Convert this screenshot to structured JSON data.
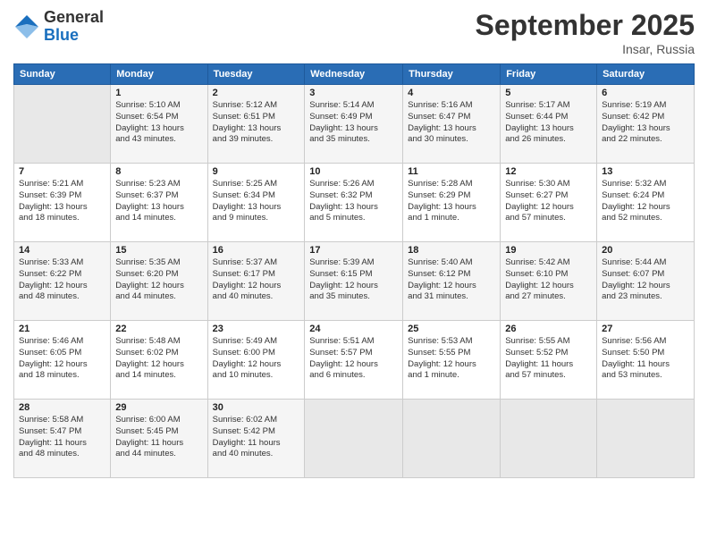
{
  "header": {
    "logo_general": "General",
    "logo_blue": "Blue",
    "month_title": "September 2025",
    "location": "Insar, Russia"
  },
  "weekdays": [
    "Sunday",
    "Monday",
    "Tuesday",
    "Wednesday",
    "Thursday",
    "Friday",
    "Saturday"
  ],
  "weeks": [
    [
      {
        "day": "",
        "info": ""
      },
      {
        "day": "1",
        "info": "Sunrise: 5:10 AM\nSunset: 6:54 PM\nDaylight: 13 hours\nand 43 minutes."
      },
      {
        "day": "2",
        "info": "Sunrise: 5:12 AM\nSunset: 6:51 PM\nDaylight: 13 hours\nand 39 minutes."
      },
      {
        "day": "3",
        "info": "Sunrise: 5:14 AM\nSunset: 6:49 PM\nDaylight: 13 hours\nand 35 minutes."
      },
      {
        "day": "4",
        "info": "Sunrise: 5:16 AM\nSunset: 6:47 PM\nDaylight: 13 hours\nand 30 minutes."
      },
      {
        "day": "5",
        "info": "Sunrise: 5:17 AM\nSunset: 6:44 PM\nDaylight: 13 hours\nand 26 minutes."
      },
      {
        "day": "6",
        "info": "Sunrise: 5:19 AM\nSunset: 6:42 PM\nDaylight: 13 hours\nand 22 minutes."
      }
    ],
    [
      {
        "day": "7",
        "info": "Sunrise: 5:21 AM\nSunset: 6:39 PM\nDaylight: 13 hours\nand 18 minutes."
      },
      {
        "day": "8",
        "info": "Sunrise: 5:23 AM\nSunset: 6:37 PM\nDaylight: 13 hours\nand 14 minutes."
      },
      {
        "day": "9",
        "info": "Sunrise: 5:25 AM\nSunset: 6:34 PM\nDaylight: 13 hours\nand 9 minutes."
      },
      {
        "day": "10",
        "info": "Sunrise: 5:26 AM\nSunset: 6:32 PM\nDaylight: 13 hours\nand 5 minutes."
      },
      {
        "day": "11",
        "info": "Sunrise: 5:28 AM\nSunset: 6:29 PM\nDaylight: 13 hours\nand 1 minute."
      },
      {
        "day": "12",
        "info": "Sunrise: 5:30 AM\nSunset: 6:27 PM\nDaylight: 12 hours\nand 57 minutes."
      },
      {
        "day": "13",
        "info": "Sunrise: 5:32 AM\nSunset: 6:24 PM\nDaylight: 12 hours\nand 52 minutes."
      }
    ],
    [
      {
        "day": "14",
        "info": "Sunrise: 5:33 AM\nSunset: 6:22 PM\nDaylight: 12 hours\nand 48 minutes."
      },
      {
        "day": "15",
        "info": "Sunrise: 5:35 AM\nSunset: 6:20 PM\nDaylight: 12 hours\nand 44 minutes."
      },
      {
        "day": "16",
        "info": "Sunrise: 5:37 AM\nSunset: 6:17 PM\nDaylight: 12 hours\nand 40 minutes."
      },
      {
        "day": "17",
        "info": "Sunrise: 5:39 AM\nSunset: 6:15 PM\nDaylight: 12 hours\nand 35 minutes."
      },
      {
        "day": "18",
        "info": "Sunrise: 5:40 AM\nSunset: 6:12 PM\nDaylight: 12 hours\nand 31 minutes."
      },
      {
        "day": "19",
        "info": "Sunrise: 5:42 AM\nSunset: 6:10 PM\nDaylight: 12 hours\nand 27 minutes."
      },
      {
        "day": "20",
        "info": "Sunrise: 5:44 AM\nSunset: 6:07 PM\nDaylight: 12 hours\nand 23 minutes."
      }
    ],
    [
      {
        "day": "21",
        "info": "Sunrise: 5:46 AM\nSunset: 6:05 PM\nDaylight: 12 hours\nand 18 minutes."
      },
      {
        "day": "22",
        "info": "Sunrise: 5:48 AM\nSunset: 6:02 PM\nDaylight: 12 hours\nand 14 minutes."
      },
      {
        "day": "23",
        "info": "Sunrise: 5:49 AM\nSunset: 6:00 PM\nDaylight: 12 hours\nand 10 minutes."
      },
      {
        "day": "24",
        "info": "Sunrise: 5:51 AM\nSunset: 5:57 PM\nDaylight: 12 hours\nand 6 minutes."
      },
      {
        "day": "25",
        "info": "Sunrise: 5:53 AM\nSunset: 5:55 PM\nDaylight: 12 hours\nand 1 minute."
      },
      {
        "day": "26",
        "info": "Sunrise: 5:55 AM\nSunset: 5:52 PM\nDaylight: 11 hours\nand 57 minutes."
      },
      {
        "day": "27",
        "info": "Sunrise: 5:56 AM\nSunset: 5:50 PM\nDaylight: 11 hours\nand 53 minutes."
      }
    ],
    [
      {
        "day": "28",
        "info": "Sunrise: 5:58 AM\nSunset: 5:47 PM\nDaylight: 11 hours\nand 48 minutes."
      },
      {
        "day": "29",
        "info": "Sunrise: 6:00 AM\nSunset: 5:45 PM\nDaylight: 11 hours\nand 44 minutes."
      },
      {
        "day": "30",
        "info": "Sunrise: 6:02 AM\nSunset: 5:42 PM\nDaylight: 11 hours\nand 40 minutes."
      },
      {
        "day": "",
        "info": ""
      },
      {
        "day": "",
        "info": ""
      },
      {
        "day": "",
        "info": ""
      },
      {
        "day": "",
        "info": ""
      }
    ]
  ]
}
